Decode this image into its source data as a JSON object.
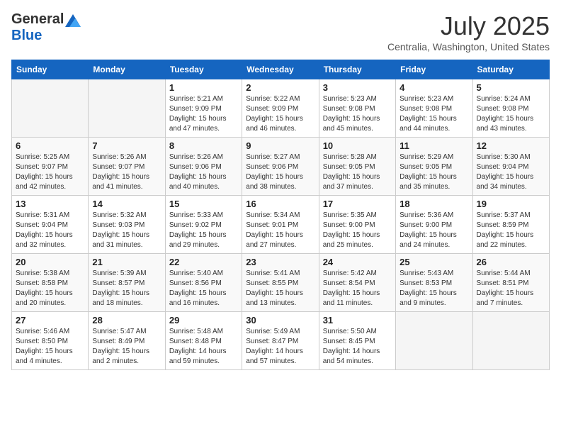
{
  "header": {
    "logo_general": "General",
    "logo_blue": "Blue",
    "month_title": "July 2025",
    "subtitle": "Centralia, Washington, United States"
  },
  "days_of_week": [
    "Sunday",
    "Monday",
    "Tuesday",
    "Wednesday",
    "Thursday",
    "Friday",
    "Saturday"
  ],
  "weeks": [
    [
      {
        "day": "",
        "sunrise": "",
        "sunset": "",
        "daylight": ""
      },
      {
        "day": "",
        "sunrise": "",
        "sunset": "",
        "daylight": ""
      },
      {
        "day": "1",
        "sunrise": "Sunrise: 5:21 AM",
        "sunset": "Sunset: 9:09 PM",
        "daylight": "Daylight: 15 hours and 47 minutes."
      },
      {
        "day": "2",
        "sunrise": "Sunrise: 5:22 AM",
        "sunset": "Sunset: 9:09 PM",
        "daylight": "Daylight: 15 hours and 46 minutes."
      },
      {
        "day": "3",
        "sunrise": "Sunrise: 5:23 AM",
        "sunset": "Sunset: 9:08 PM",
        "daylight": "Daylight: 15 hours and 45 minutes."
      },
      {
        "day": "4",
        "sunrise": "Sunrise: 5:23 AM",
        "sunset": "Sunset: 9:08 PM",
        "daylight": "Daylight: 15 hours and 44 minutes."
      },
      {
        "day": "5",
        "sunrise": "Sunrise: 5:24 AM",
        "sunset": "Sunset: 9:08 PM",
        "daylight": "Daylight: 15 hours and 43 minutes."
      }
    ],
    [
      {
        "day": "6",
        "sunrise": "Sunrise: 5:25 AM",
        "sunset": "Sunset: 9:07 PM",
        "daylight": "Daylight: 15 hours and 42 minutes."
      },
      {
        "day": "7",
        "sunrise": "Sunrise: 5:26 AM",
        "sunset": "Sunset: 9:07 PM",
        "daylight": "Daylight: 15 hours and 41 minutes."
      },
      {
        "day": "8",
        "sunrise": "Sunrise: 5:26 AM",
        "sunset": "Sunset: 9:06 PM",
        "daylight": "Daylight: 15 hours and 40 minutes."
      },
      {
        "day": "9",
        "sunrise": "Sunrise: 5:27 AM",
        "sunset": "Sunset: 9:06 PM",
        "daylight": "Daylight: 15 hours and 38 minutes."
      },
      {
        "day": "10",
        "sunrise": "Sunrise: 5:28 AM",
        "sunset": "Sunset: 9:05 PM",
        "daylight": "Daylight: 15 hours and 37 minutes."
      },
      {
        "day": "11",
        "sunrise": "Sunrise: 5:29 AM",
        "sunset": "Sunset: 9:05 PM",
        "daylight": "Daylight: 15 hours and 35 minutes."
      },
      {
        "day": "12",
        "sunrise": "Sunrise: 5:30 AM",
        "sunset": "Sunset: 9:04 PM",
        "daylight": "Daylight: 15 hours and 34 minutes."
      }
    ],
    [
      {
        "day": "13",
        "sunrise": "Sunrise: 5:31 AM",
        "sunset": "Sunset: 9:04 PM",
        "daylight": "Daylight: 15 hours and 32 minutes."
      },
      {
        "day": "14",
        "sunrise": "Sunrise: 5:32 AM",
        "sunset": "Sunset: 9:03 PM",
        "daylight": "Daylight: 15 hours and 31 minutes."
      },
      {
        "day": "15",
        "sunrise": "Sunrise: 5:33 AM",
        "sunset": "Sunset: 9:02 PM",
        "daylight": "Daylight: 15 hours and 29 minutes."
      },
      {
        "day": "16",
        "sunrise": "Sunrise: 5:34 AM",
        "sunset": "Sunset: 9:01 PM",
        "daylight": "Daylight: 15 hours and 27 minutes."
      },
      {
        "day": "17",
        "sunrise": "Sunrise: 5:35 AM",
        "sunset": "Sunset: 9:00 PM",
        "daylight": "Daylight: 15 hours and 25 minutes."
      },
      {
        "day": "18",
        "sunrise": "Sunrise: 5:36 AM",
        "sunset": "Sunset: 9:00 PM",
        "daylight": "Daylight: 15 hours and 24 minutes."
      },
      {
        "day": "19",
        "sunrise": "Sunrise: 5:37 AM",
        "sunset": "Sunset: 8:59 PM",
        "daylight": "Daylight: 15 hours and 22 minutes."
      }
    ],
    [
      {
        "day": "20",
        "sunrise": "Sunrise: 5:38 AM",
        "sunset": "Sunset: 8:58 PM",
        "daylight": "Daylight: 15 hours and 20 minutes."
      },
      {
        "day": "21",
        "sunrise": "Sunrise: 5:39 AM",
        "sunset": "Sunset: 8:57 PM",
        "daylight": "Daylight: 15 hours and 18 minutes."
      },
      {
        "day": "22",
        "sunrise": "Sunrise: 5:40 AM",
        "sunset": "Sunset: 8:56 PM",
        "daylight": "Daylight: 15 hours and 16 minutes."
      },
      {
        "day": "23",
        "sunrise": "Sunrise: 5:41 AM",
        "sunset": "Sunset: 8:55 PM",
        "daylight": "Daylight: 15 hours and 13 minutes."
      },
      {
        "day": "24",
        "sunrise": "Sunrise: 5:42 AM",
        "sunset": "Sunset: 8:54 PM",
        "daylight": "Daylight: 15 hours and 11 minutes."
      },
      {
        "day": "25",
        "sunrise": "Sunrise: 5:43 AM",
        "sunset": "Sunset: 8:53 PM",
        "daylight": "Daylight: 15 hours and 9 minutes."
      },
      {
        "day": "26",
        "sunrise": "Sunrise: 5:44 AM",
        "sunset": "Sunset: 8:51 PM",
        "daylight": "Daylight: 15 hours and 7 minutes."
      }
    ],
    [
      {
        "day": "27",
        "sunrise": "Sunrise: 5:46 AM",
        "sunset": "Sunset: 8:50 PM",
        "daylight": "Daylight: 15 hours and 4 minutes."
      },
      {
        "day": "28",
        "sunrise": "Sunrise: 5:47 AM",
        "sunset": "Sunset: 8:49 PM",
        "daylight": "Daylight: 15 hours and 2 minutes."
      },
      {
        "day": "29",
        "sunrise": "Sunrise: 5:48 AM",
        "sunset": "Sunset: 8:48 PM",
        "daylight": "Daylight: 14 hours and 59 minutes."
      },
      {
        "day": "30",
        "sunrise": "Sunrise: 5:49 AM",
        "sunset": "Sunset: 8:47 PM",
        "daylight": "Daylight: 14 hours and 57 minutes."
      },
      {
        "day": "31",
        "sunrise": "Sunrise: 5:50 AM",
        "sunset": "Sunset: 8:45 PM",
        "daylight": "Daylight: 14 hours and 54 minutes."
      },
      {
        "day": "",
        "sunrise": "",
        "sunset": "",
        "daylight": ""
      },
      {
        "day": "",
        "sunrise": "",
        "sunset": "",
        "daylight": ""
      }
    ]
  ]
}
